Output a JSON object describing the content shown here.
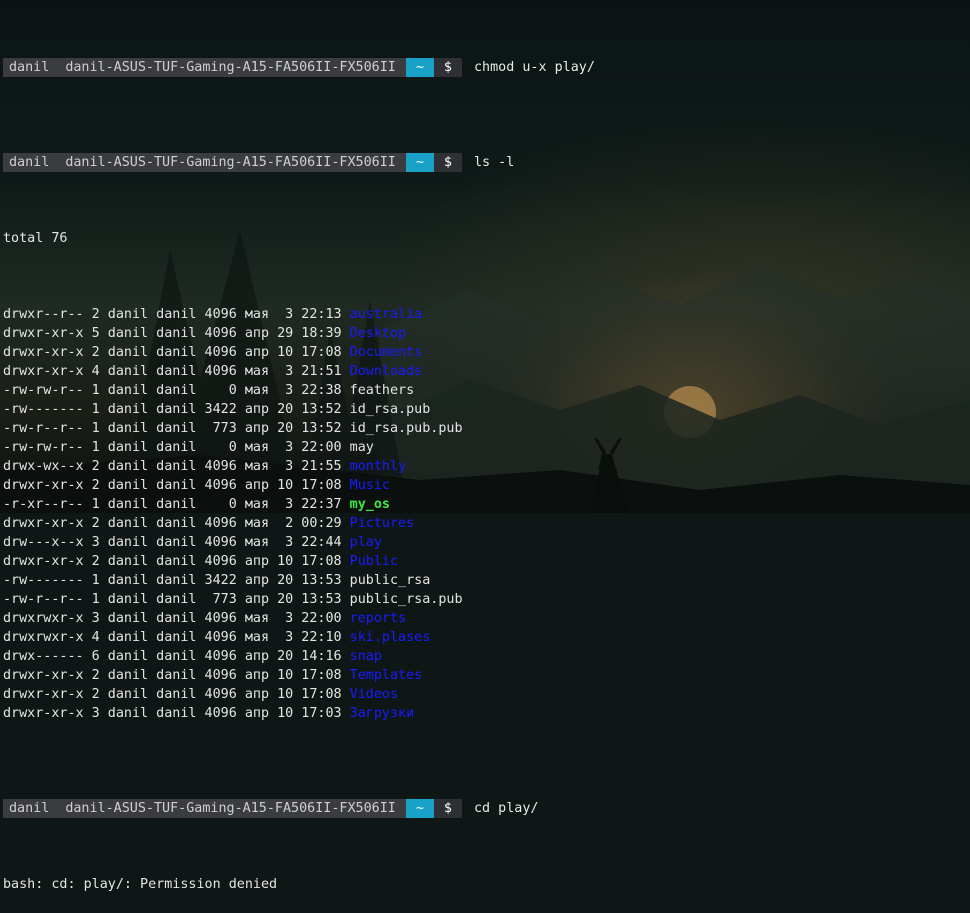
{
  "prompt": {
    "user": "danil",
    "host": "danil-ASUS-TUF-Gaming-A15-FA506II-FX506II",
    "dir": "~",
    "symbol": "$"
  },
  "commands": [
    "chmod u-x play/",
    "ls -l",
    "cd play/"
  ],
  "total": "total 76",
  "listing": [
    {
      "meta": "drwxr--r-- 2 danil danil 4096 мая  3 22:13 ",
      "name": "australia",
      "type": "dir"
    },
    {
      "meta": "drwxr-xr-x 5 danil danil 4096 апр 29 18:39 ",
      "name": "Desktop",
      "type": "dir"
    },
    {
      "meta": "drwxr-xr-x 2 danil danil 4096 апр 10 17:08 ",
      "name": "Documents",
      "type": "dir"
    },
    {
      "meta": "drwxr-xr-x 4 danil danil 4096 мая  3 21:51 ",
      "name": "Downloads",
      "type": "dir"
    },
    {
      "meta": "-rw-rw-r-- 1 danil danil    0 мая  3 22:38 ",
      "name": "feathers",
      "type": "file"
    },
    {
      "meta": "-rw------- 1 danil danil 3422 апр 20 13:52 ",
      "name": "id_rsa.pub",
      "type": "file"
    },
    {
      "meta": "-rw-r--r-- 1 danil danil  773 апр 20 13:52 ",
      "name": "id_rsa.pub.pub",
      "type": "file"
    },
    {
      "meta": "-rw-rw-r-- 1 danil danil    0 мая  3 22:00 ",
      "name": "may",
      "type": "file"
    },
    {
      "meta": "drwx-wx--x 2 danil danil 4096 мая  3 21:55 ",
      "name": "monthly",
      "type": "dir"
    },
    {
      "meta": "drwxr-xr-x 2 danil danil 4096 апр 10 17:08 ",
      "name": "Music",
      "type": "dir"
    },
    {
      "meta": "-r-xr--r-- 1 danil danil    0 мая  3 22:37 ",
      "name": "my_os",
      "type": "exec"
    },
    {
      "meta": "drwxr-xr-x 2 danil danil 4096 мая  2 00:29 ",
      "name": "Pictures",
      "type": "dir"
    },
    {
      "meta": "drw---x--x 3 danil danil 4096 мая  3 22:44 ",
      "name": "play",
      "type": "dir"
    },
    {
      "meta": "drwxr-xr-x 2 danil danil 4096 апр 10 17:08 ",
      "name": "Public",
      "type": "dir"
    },
    {
      "meta": "-rw------- 1 danil danil 3422 апр 20 13:53 ",
      "name": "public_rsa",
      "type": "file"
    },
    {
      "meta": "-rw-r--r-- 1 danil danil  773 апр 20 13:53 ",
      "name": "public_rsa.pub",
      "type": "file"
    },
    {
      "meta": "drwxrwxr-x 3 danil danil 4096 мая  3 22:00 ",
      "name": "reports",
      "type": "dir"
    },
    {
      "meta": "drwxrwxr-x 4 danil danil 4096 мая  3 22:10 ",
      "name": "ski.plases",
      "type": "dir"
    },
    {
      "meta": "drwx------ 6 danil danil 4096 апр 20 14:16 ",
      "name": "snap",
      "type": "dir"
    },
    {
      "meta": "drwxr-xr-x 2 danil danil 4096 апр 10 17:08 ",
      "name": "Templates",
      "type": "dir"
    },
    {
      "meta": "drwxr-xr-x 2 danil danil 4096 апр 10 17:08 ",
      "name": "Videos",
      "type": "dir"
    },
    {
      "meta": "drwxr-xr-x 3 danil danil 4096 апр 10 17:03 ",
      "name": "Загрузки",
      "type": "dir"
    }
  ],
  "error": "bash: cd: play/: Permission denied",
  "colors": {
    "directory": "#1a1aff",
    "executable": "#3ee83e",
    "prompt_dir_bg": "#1aa1c7",
    "prompt_bg": "#3a3c3f"
  }
}
